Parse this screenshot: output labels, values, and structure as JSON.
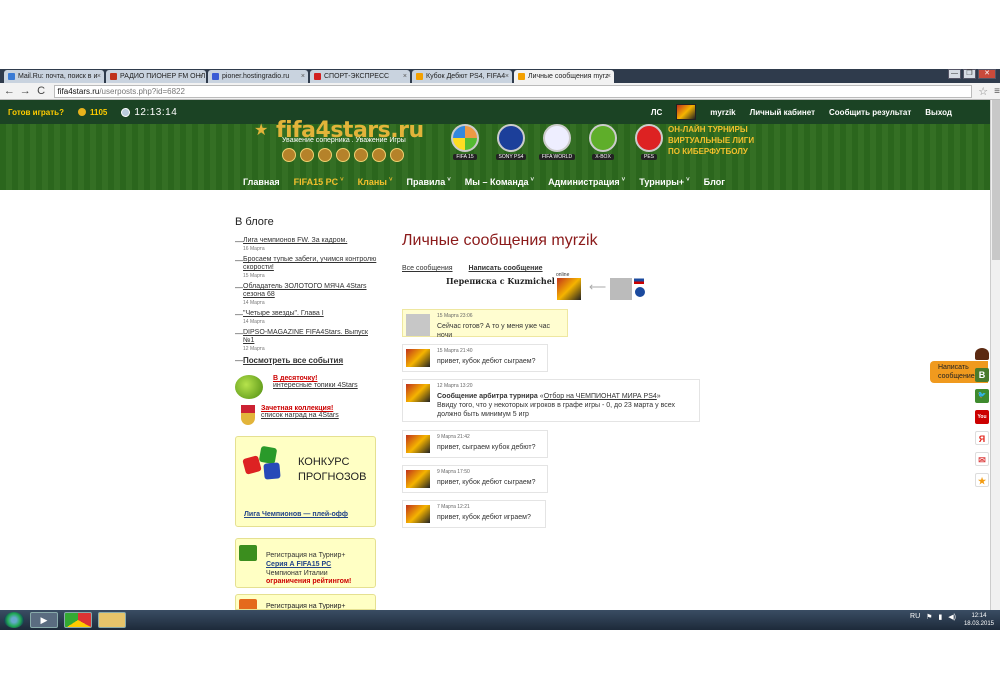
{
  "browser": {
    "tabs": [
      {
        "label": "Mail.Ru: почта, поиск в и",
        "color": "#3a7bd5"
      },
      {
        "label": "РАДИО ПИОНЕР FM ОНЛ",
        "color": "#c0311b"
      },
      {
        "label": "pioner.hostingradio.ru",
        "color": "#3a5bd5"
      },
      {
        "label": "СПОРТ-ЭКСПРЕСС",
        "color": "#d12020"
      },
      {
        "label": "Кубок Дебют PS4, FIFA4",
        "color": "#f3a000"
      },
      {
        "label": "Личные сообщения myrz",
        "color": "#f3a000"
      }
    ],
    "url_host": "fifa4stars.ru",
    "url_path": "/userposts.php?id=6822",
    "tab_close": "×",
    "win_minimize": "—",
    "win_maximize": "❐",
    "win_close": "✕"
  },
  "sitebar": {
    "ready": "Готов играть?",
    "coins": "1105",
    "clock": "12:13:14",
    "links": {
      "ls": "ЛС",
      "username": "myrzik",
      "cabinet": "Личный кабинет",
      "report": "Сообщить результат",
      "logout": "Выход"
    }
  },
  "banner": {
    "logo": "fifa4stars.ru",
    "slogan": "Уважение соперника . Уважение Игры",
    "platforms": [
      "FIFA 15",
      "SONY PS4",
      "FIFA WORLD",
      "X-BOX",
      "PES"
    ],
    "tagline": [
      "ОН-ЛАЙН ТУРНИРЫ",
      "ВИРТУАЛЬНЫЕ ЛИГИ",
      "ПО КИБЕРФУТБОЛУ"
    ],
    "nav": [
      {
        "label": "Главная",
        "caret": ""
      },
      {
        "label": "FIFA15 PC",
        "caret": "˅",
        "hl": true
      },
      {
        "label": "Кланы",
        "caret": "˅",
        "hl": true
      },
      {
        "label": "Правила",
        "caret": "˅"
      },
      {
        "label": "Мы – Команда",
        "caret": "˅"
      },
      {
        "label": "Администрация",
        "caret": "˅"
      },
      {
        "label": "Турниры+",
        "caret": "˅"
      },
      {
        "label": "Блог",
        "caret": ""
      }
    ]
  },
  "sidebar": {
    "title": "В блоге",
    "blog": [
      {
        "title": "Лига чемпионов FW. За кадром.",
        "date": "16 Марта"
      },
      {
        "title": "Бросаем тупые забеги, учимся контролю скорости!",
        "date": "15 Марта"
      },
      {
        "title": "Обладатель ЗОЛОТОГО МЯЧА 4Stars сезона 68",
        "date": "14 Марта"
      },
      {
        "title": "\"Четыре звезды\". Глава I",
        "date": "14 Марта"
      },
      {
        "title": "DIPSO-MAGAZINE FIFA4Stars. Выпуск №1",
        "date": "12 Марта"
      }
    ],
    "view_all": "Посмотреть все события",
    "top10_title": "В десяточку!",
    "top10_sub": "интересные топики 4Stars",
    "collection_title": "Зачетная коллекция!",
    "collection_sub": "список наград на 4Stars",
    "forecast_line1": "КОНКУРС",
    "forecast_line2": "ПРОГНОЗОВ",
    "forecast_link": "Лига Чемпионов — плей-офф",
    "reg": {
      "line1": "Регистрация на Турнир+",
      "line2": "Серия А FIFA15 PC",
      "line3": "Чемпионат Италии",
      "line4": "ограничения рейтингом!"
    },
    "reg2": "Регистрация на Турнир+"
  },
  "main": {
    "title": "Личные сообщения myrzik",
    "tab_all": "Все сообщения",
    "tab_write": "Написать сообщение",
    "conversation": "Переписка с Kuzmichel",
    "online": "online",
    "arrow": "⟵",
    "messages": [
      {
        "date": "15 Марта 23:06",
        "text": "Сейчас готов? А то у меня уже час ночи",
        "mine": true
      },
      {
        "date": "15 Марта 21:40",
        "text": "привет, кубок дебют сыграем?"
      },
      {
        "date": "12 Марта 13:20",
        "prefix": "Сообщение арбитра турнира",
        "open_quote": "«",
        "link": "Отбор на ЧЕМПИОНАТ МИРА PS4",
        "close_quote": "»",
        "text": "Ввиду того, что у некоторых игроков в графе игры - 0, до 23 марта у всех должно быть минимум 5 игр"
      },
      {
        "date": "9 Марта 21:42",
        "text": "привет, сыграем кубок дебют?"
      },
      {
        "date": "9 Марта 17:50",
        "text": "привет, кубок дебют сыграем?"
      },
      {
        "date": "7 Марта 12:21",
        "text": "привет, кубок дебют играем?"
      }
    ]
  },
  "right": {
    "feedback": "Написать сообщение",
    "social": [
      {
        "letter": "В",
        "color": "#4a7b2b"
      },
      {
        "letter": "🐦",
        "color": "#3f8b2e"
      },
      {
        "letter": "You",
        "color": "#c00"
      },
      {
        "letter": "Я",
        "color": "#e3261c"
      },
      {
        "letter": "✉",
        "color": "#d44"
      },
      {
        "letter": "★",
        "color": "#f39c12"
      }
    ]
  },
  "taskbar": {
    "lang": "RU",
    "time": "12:14",
    "date": "18.03.2015"
  }
}
